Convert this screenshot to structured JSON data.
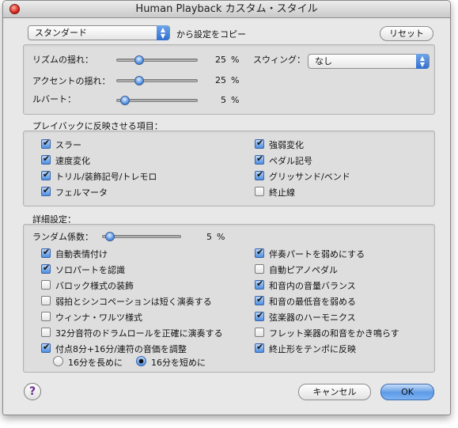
{
  "window": {
    "title": "Human Playback カスタム・スタイル"
  },
  "preset": {
    "selected": "スタンダード",
    "copy_label": "から設定をコピー",
    "reset_label": "リセット"
  },
  "rhythm": {
    "sliders": [
      {
        "label": "リズムの揺れ：",
        "value": "25",
        "unit": "%",
        "level": 0.25
      },
      {
        "label": "アクセントの揺れ：",
        "value": "25",
        "unit": "%",
        "level": 0.25
      },
      {
        "label": "ルバート：",
        "value": "5",
        "unit": "%",
        "level": 0.05
      }
    ],
    "swing_label": "スウィング：",
    "swing_value": "なし"
  },
  "playback_items": {
    "heading": "プレイバックに反映させる項目：",
    "left": [
      {
        "label": "スラー",
        "checked": true
      },
      {
        "label": "速度変化",
        "checked": true
      },
      {
        "label": "トリル/装飾記号/トレモロ",
        "checked": true
      },
      {
        "label": "フェルマータ",
        "checked": true
      }
    ],
    "right": [
      {
        "label": "強弱変化",
        "checked": true
      },
      {
        "label": "ペダル記号",
        "checked": true
      },
      {
        "label": "グリッサンド/ベンド",
        "checked": true
      },
      {
        "label": "終止線",
        "checked": false
      }
    ]
  },
  "details": {
    "heading": "詳細設定：",
    "random": {
      "label": "ランダム係数：",
      "value": "5",
      "unit": "%",
      "level": 0.05
    },
    "left": [
      {
        "label": "自動表情付け",
        "checked": true
      },
      {
        "label": "ソロパートを認識",
        "checked": true
      },
      {
        "label": "バロック様式の装飾",
        "checked": false
      },
      {
        "label": "弱拍とシンコペーションは短く演奏する",
        "checked": false
      },
      {
        "label": "ウィンナ・ワルツ様式",
        "checked": false
      },
      {
        "label": "32分音符のドラムロールを正確に演奏する",
        "checked": false
      },
      {
        "label": "付点8分+16分/連符の音価を調整",
        "checked": true
      }
    ],
    "right": [
      {
        "label": "伴奏パートを弱めにする",
        "checked": true
      },
      {
        "label": "自動ピアノペダル",
        "checked": false
      },
      {
        "label": "和音内の音量バランス",
        "checked": true
      },
      {
        "label": "和音の最低音を弱める",
        "checked": true
      },
      {
        "label": "弦楽器のハーモニクス",
        "checked": true
      },
      {
        "label": "フレット楽器の和音をかき鳴らす",
        "checked": false
      },
      {
        "label": "終止形をテンポに反映",
        "checked": true
      }
    ],
    "radios": [
      {
        "label": "16分を長めに",
        "selected": false
      },
      {
        "label": "16分を短めに",
        "selected": true
      }
    ]
  },
  "footer": {
    "help": "?",
    "cancel": "キャンセル",
    "ok": "OK"
  }
}
